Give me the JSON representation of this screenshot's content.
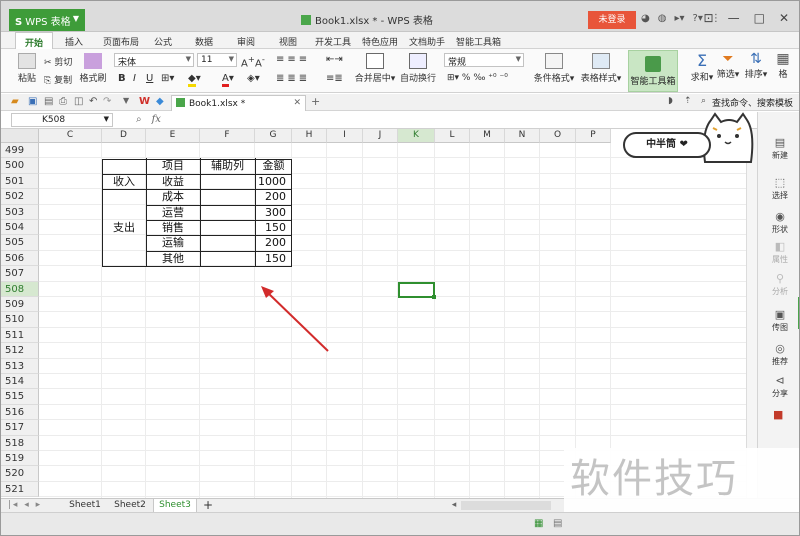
{
  "app": {
    "title": "WPS 表格",
    "doc_title": "Book1.xlsx * - WPS 表格",
    "login": "未登录"
  },
  "tabs": [
    "开始",
    "插入",
    "页面布局",
    "公式",
    "数据",
    "审阅",
    "视图",
    "开发工具",
    "特色应用",
    "文档助手",
    "智能工具箱"
  ],
  "ribbon": {
    "paste": "粘贴",
    "cut": "剪切",
    "copy": "复制",
    "format_painter": "格式刷",
    "font_name": "宋体",
    "font_size": "11",
    "bold": "B",
    "italic": "I",
    "underline": "U",
    "merge_center": "合并居中",
    "wrap": "自动换行",
    "number_format": "常规",
    "cond_format": "条件格式",
    "table_style": "表格样式",
    "smart_toolbox": "智能工具箱",
    "sum": "求和",
    "filter": "筛选",
    "sort": "排序",
    "more": "格"
  },
  "quickbar": {
    "file_tab": "Book1.xlsx *",
    "search": "查找命令、搜索模板"
  },
  "formula_bar": {
    "cell_ref": "K508",
    "fx": "fx"
  },
  "columns": [
    "C",
    "D",
    "E",
    "F",
    "G",
    "H",
    "I",
    "J",
    "K",
    "L",
    "M",
    "N",
    "O",
    "P"
  ],
  "selected_column": "K",
  "rows": [
    "499",
    "500",
    "501",
    "502",
    "503",
    "504",
    "505",
    "506",
    "507",
    "508",
    "509",
    "510",
    "511",
    "512",
    "513",
    "514",
    "515",
    "516",
    "517",
    "518",
    "519",
    "520",
    "521"
  ],
  "selected_row": "508",
  "table": {
    "headers": [
      "项目",
      "辅助列",
      "金额"
    ],
    "income_label": "收入",
    "expense_label": "支出",
    "items": [
      {
        "name": "收益",
        "amount": "1000"
      },
      {
        "name": "成本",
        "amount": "200"
      },
      {
        "name": "运营",
        "amount": "300"
      },
      {
        "name": "销售",
        "amount": "150"
      },
      {
        "name": "运输",
        "amount": "200"
      },
      {
        "name": "其他",
        "amount": "150"
      }
    ]
  },
  "mascot_text": "中半筒 ❤",
  "sidebar": [
    {
      "label": "新建",
      "icon": "new-doc-icon"
    },
    {
      "label": "选择",
      "icon": "select-icon"
    },
    {
      "label": "形状",
      "icon": "shape-icon"
    },
    {
      "label": "属性",
      "icon": "property-icon"
    },
    {
      "label": "分析",
      "icon": "analysis-icon"
    },
    {
      "label": "传图",
      "icon": "upload-image-icon"
    },
    {
      "label": "推荐",
      "icon": "recommend-icon"
    },
    {
      "label": "分享",
      "icon": "share-icon"
    }
  ],
  "sheets": [
    "Sheet1",
    "Sheet2",
    "Sheet3"
  ],
  "active_sheet": "Sheet3",
  "watermark": "软件技巧",
  "colors": {
    "accent_green": "#3e9c39",
    "login_red": "#e8553a",
    "arrow_red": "#d22b2b"
  }
}
